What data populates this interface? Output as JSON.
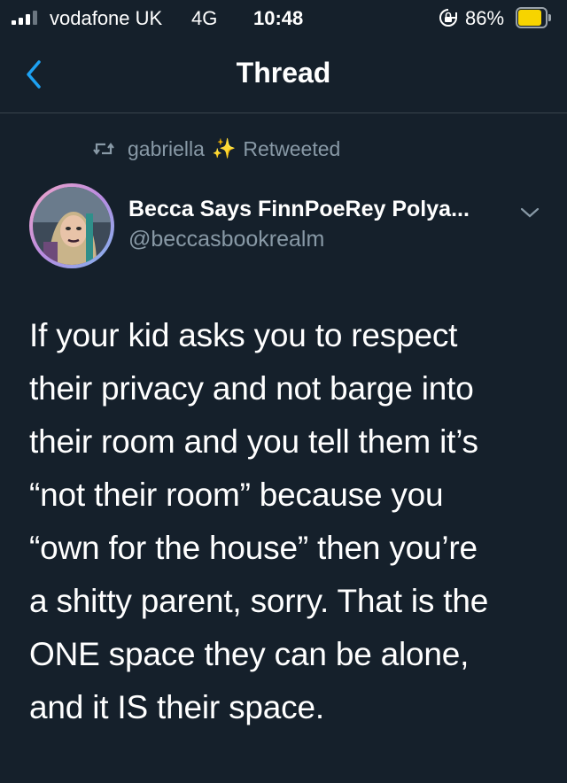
{
  "status_bar": {
    "carrier": "vodafone UK",
    "network": "4G",
    "time": "10:48",
    "battery_percent": "86%",
    "battery_level": 0.86,
    "battery_color": "#f7d400",
    "signal_icon": "signal-bars-icon",
    "lock_icon": "orientation-lock-icon"
  },
  "nav": {
    "title": "Thread",
    "back_icon": "chevron-left-icon",
    "accent": "#1da1f2"
  },
  "retweet": {
    "icon": "retweet-icon",
    "user": "gabriella",
    "emoji": "✨",
    "action": "Retweeted"
  },
  "tweet": {
    "display_name": "Becca Says FinnPoeRey Polya...",
    "handle": "@beccasbookrealm",
    "text_lines": [
      "If your kid asks you to respect",
      "their privacy and not barge into",
      "their room and you tell them it’s",
      "“not their room” because you",
      "“own for the house” then you’re",
      "a shitty parent, sorry. That is the",
      "ONE space they can be alone,",
      "and it IS their space."
    ]
  }
}
